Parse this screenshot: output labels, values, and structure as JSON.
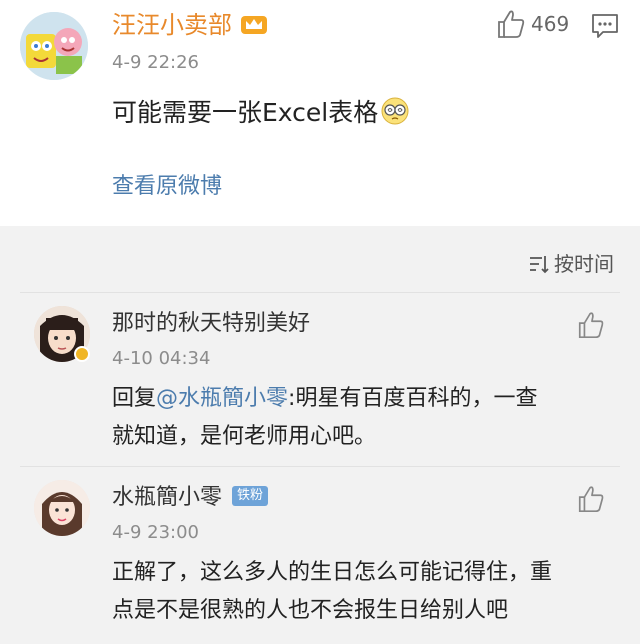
{
  "post": {
    "username": "汪汪小卖部",
    "time": "4-9 22:26",
    "content": "可能需要一张Excel表格",
    "view_original": "查看原微博",
    "like_count": "469"
  },
  "sort_label": "按时间",
  "comments": [
    {
      "name": "那时的秋天特别美好",
      "time": "4-10 04:34",
      "reply_prefix": "回复",
      "mention": "@水瓶簡小零",
      "text_line1_rest": ":明星有百度百科的，一查",
      "text_line2": "就知道，是何老师用心吧。"
    },
    {
      "name": "水瓶簡小零",
      "badge": "铁粉",
      "time": "4-9 23:00",
      "text_line1": "正解了，这么多人的生日怎么可能记得住，重",
      "text_line2": "点是不是很熟的人也不会报生日给别人吧"
    }
  ],
  "colors": {
    "username": "#e8892b",
    "link": "#4c7cad",
    "muted": "#8c8c8c",
    "badge": "#6ea3d8"
  }
}
